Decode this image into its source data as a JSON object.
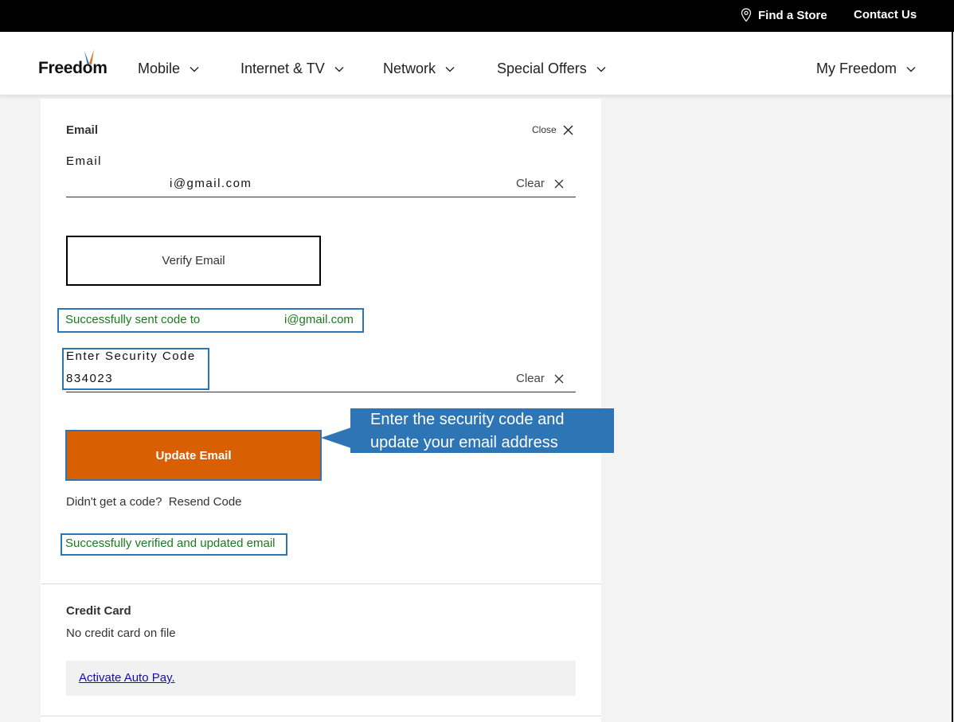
{
  "utility": {
    "find_store": "Find a Store",
    "contact_us": "Contact Us"
  },
  "header": {
    "logo": "Freedom",
    "nav": [
      {
        "label": "Mobile"
      },
      {
        "label": "Internet & TV"
      },
      {
        "label": "Network"
      },
      {
        "label": "Special Offers"
      }
    ],
    "account": "My Freedom"
  },
  "email_section": {
    "title": "Email",
    "close_label": "Close",
    "email_label": "Email",
    "email_value": "i@gmail.com",
    "clear_label": "Clear",
    "verify_button": "Verify Email",
    "sent_message_prefix": "Successfully sent code to",
    "sent_message_email": "i@gmail.com",
    "security_code_label": "Enter Security Code",
    "security_code_value": "834023",
    "clear_label_2": "Clear",
    "update_button": "Update Email",
    "no_code_text": "Didn't get a code?",
    "resend_link": "Resend Code",
    "updated_message": "Successfully verified and updated email"
  },
  "callout": {
    "line1": "Enter the security code and",
    "line2": "update your email address"
  },
  "credit_card_section": {
    "title": "Credit Card",
    "status": "No credit card on file",
    "autopay_link": "Activate Auto Pay."
  },
  "colors": {
    "accent_orange": "#d95f05",
    "annotation_blue": "#2e75b6",
    "success_green": "#1b7a1b"
  }
}
